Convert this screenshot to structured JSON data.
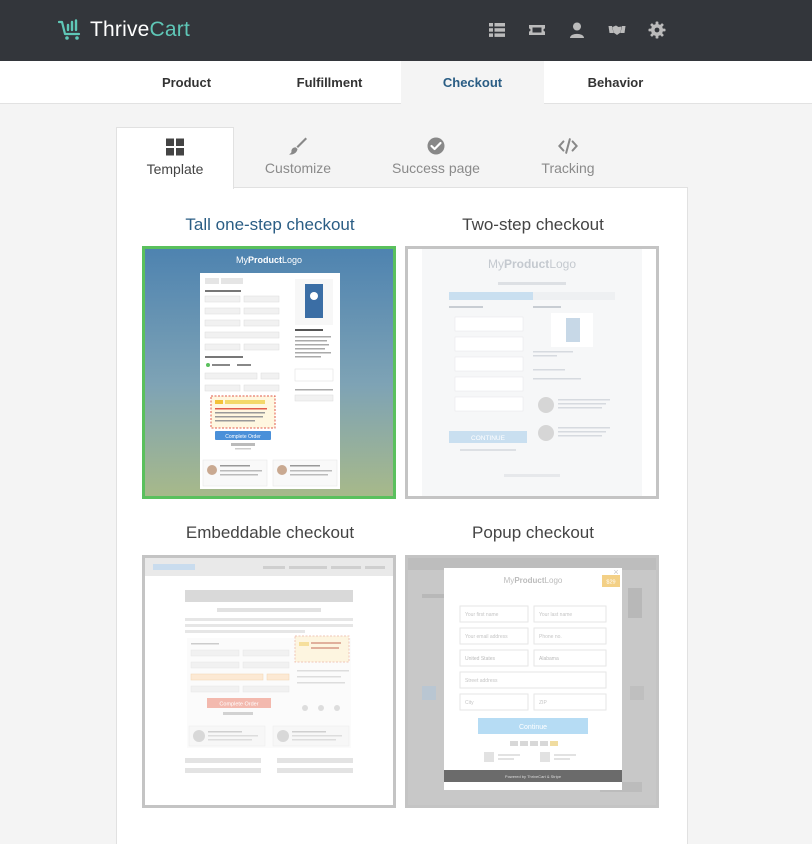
{
  "app": {
    "brand_part1": "Thrive",
    "brand_part2": "Cart",
    "accent_color": "#5fc7b7",
    "header_icons": [
      "grid-list-icon",
      "ticket-icon",
      "user-icon",
      "handshake-icon",
      "gear-icon"
    ]
  },
  "main_tabs": [
    {
      "label": "Product",
      "active": false
    },
    {
      "label": "Fulfillment",
      "active": false
    },
    {
      "label": "Checkout",
      "active": true
    },
    {
      "label": "Behavior",
      "active": false
    }
  ],
  "sub_tabs": [
    {
      "label": "Template",
      "icon": "grid-icon",
      "active": true
    },
    {
      "label": "Customize",
      "icon": "brush-icon",
      "active": false
    },
    {
      "label": "Success page",
      "icon": "check-circle-icon",
      "active": false
    },
    {
      "label": "Tracking",
      "icon": "code-icon",
      "active": false
    }
  ],
  "templates": [
    {
      "title": "Tall one-step checkout",
      "selected": true
    },
    {
      "title": "Two-step checkout",
      "selected": false
    },
    {
      "title": "Embeddable checkout",
      "selected": false
    },
    {
      "title": "Popup checkout",
      "selected": false
    }
  ],
  "previews": {
    "logo_prefix": "My",
    "logo_bold": "Product",
    "logo_suffix": "Logo",
    "complete_order": "Complete Order",
    "continue": "Continue",
    "continue_upper": "CONTINUE",
    "two_step_heading": "Don't Miss This Amazing Offer!",
    "your_information": "Your Information",
    "order_details": "Order details",
    "contact_information": "Contact Information",
    "payment_information": "Payment Information",
    "what_you_get": "What you get",
    "popup_fields": [
      "Your first name",
      "Your last name",
      "Your email address",
      "Phone no.",
      "United States",
      "Alabama",
      "Street address",
      "City",
      "ZIP"
    ],
    "popup_price": "$29",
    "popup_footer": "Powered by ThriveCart & Stripe",
    "select_colors": {
      "blue_top": "#4e83b0",
      "green_bottom": "#a7b98a",
      "button_blue": "#4a90d9"
    }
  }
}
